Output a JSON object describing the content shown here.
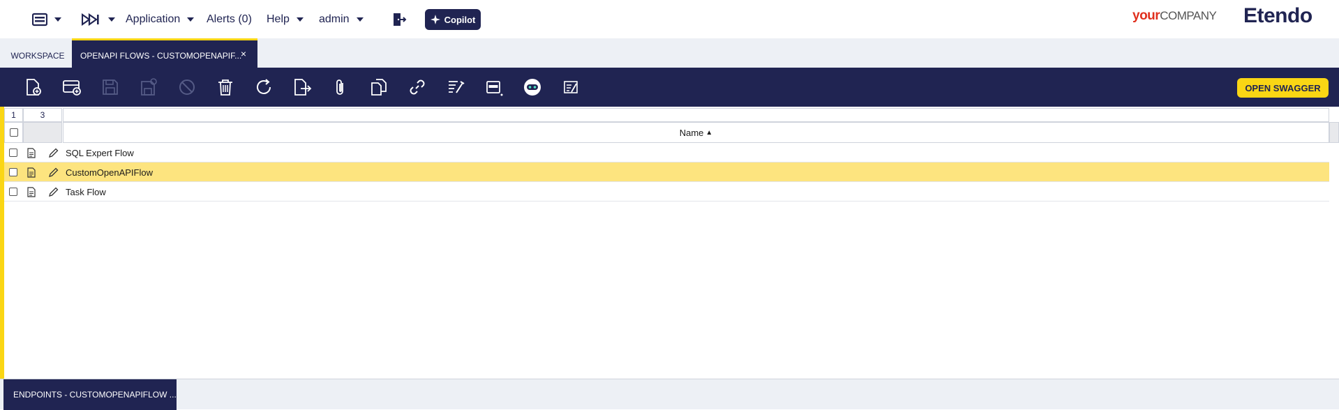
{
  "topnav": {
    "menu_icon": "grid-menu-icon",
    "quicklaunch_icon": "fast-forward-icon",
    "application_label": "Application",
    "alerts_label": "Alerts (0)",
    "help_label": "Help",
    "user_label": "admin",
    "logout_icon": "logout-icon",
    "copilot_label": "Copilot",
    "logo_your": "your",
    "logo_company": "COMPANY",
    "logo_brand": "Etendo"
  },
  "tabs": {
    "workspace_label": "WORKSPACE",
    "active_label": "OPENAPI FLOWS - CUSTOMOPENAPIF...",
    "close_symbol": "×"
  },
  "toolbar": {
    "icons": [
      "new-document-icon",
      "new-row-icon",
      "save-icon",
      "save-close-icon",
      "undo-icon",
      "delete-icon",
      "refresh-icon",
      "export-icon",
      "attachment-icon",
      "clone-icon",
      "link-icon",
      "audit-icon",
      "grid-view-icon",
      "copilot-bot-icon",
      "translate-icon"
    ],
    "swagger_label": "OPEN SWAGGER",
    "colors": {
      "bar": "#202452",
      "accent": "#fad614"
    }
  },
  "grid": {
    "selected_count": "1",
    "total_count": "3",
    "column_name": "Name",
    "sort_indicator": "▲",
    "rows": [
      {
        "name": "SQL Expert Flow",
        "selected": false
      },
      {
        "name": "CustomOpenAPIFlow",
        "selected": true
      },
      {
        "name": "Task Flow",
        "selected": false
      }
    ]
  },
  "bottom": {
    "tab_label": "ENDPOINTS - CUSTOMOPENAPIFLOW ..."
  }
}
